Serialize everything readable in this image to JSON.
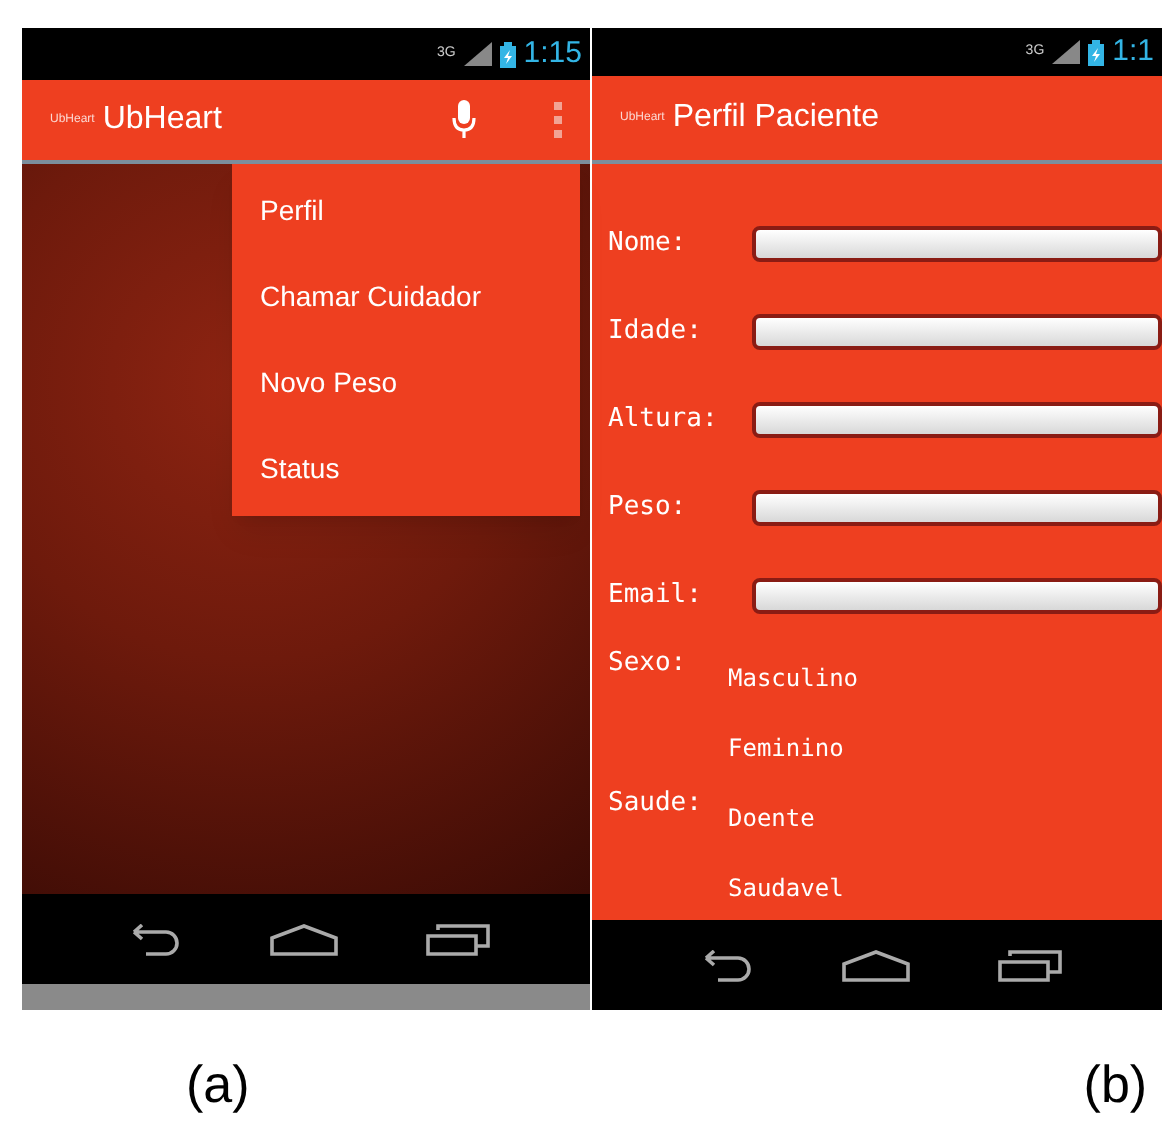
{
  "screen_a": {
    "status_bar": {
      "network": "3G",
      "time": "1:15"
    },
    "action_bar": {
      "logo": "UbHeart",
      "title": "UbHeart"
    },
    "menu": [
      {
        "label": "Perfil"
      },
      {
        "label": "Chamar Cuidador"
      },
      {
        "label": "Novo Peso"
      },
      {
        "label": "Status"
      }
    ],
    "caption": "(a)"
  },
  "screen_b": {
    "status_bar": {
      "network": "3G",
      "time": "1:1"
    },
    "action_bar": {
      "logo": "UbHeart",
      "title": "Perfil Paciente"
    },
    "fields": [
      {
        "label": "Nome:"
      },
      {
        "label": "Idade:"
      },
      {
        "label": "Altura:"
      },
      {
        "label": "Peso:"
      },
      {
        "label": "Email:"
      }
    ],
    "options": [
      {
        "label": "Sexo:",
        "choices": [
          "Masculino",
          "Feminino"
        ]
      },
      {
        "label": "Saude:",
        "choices": [
          "Doente",
          "Saudavel"
        ]
      }
    ],
    "caption": "(b)"
  }
}
